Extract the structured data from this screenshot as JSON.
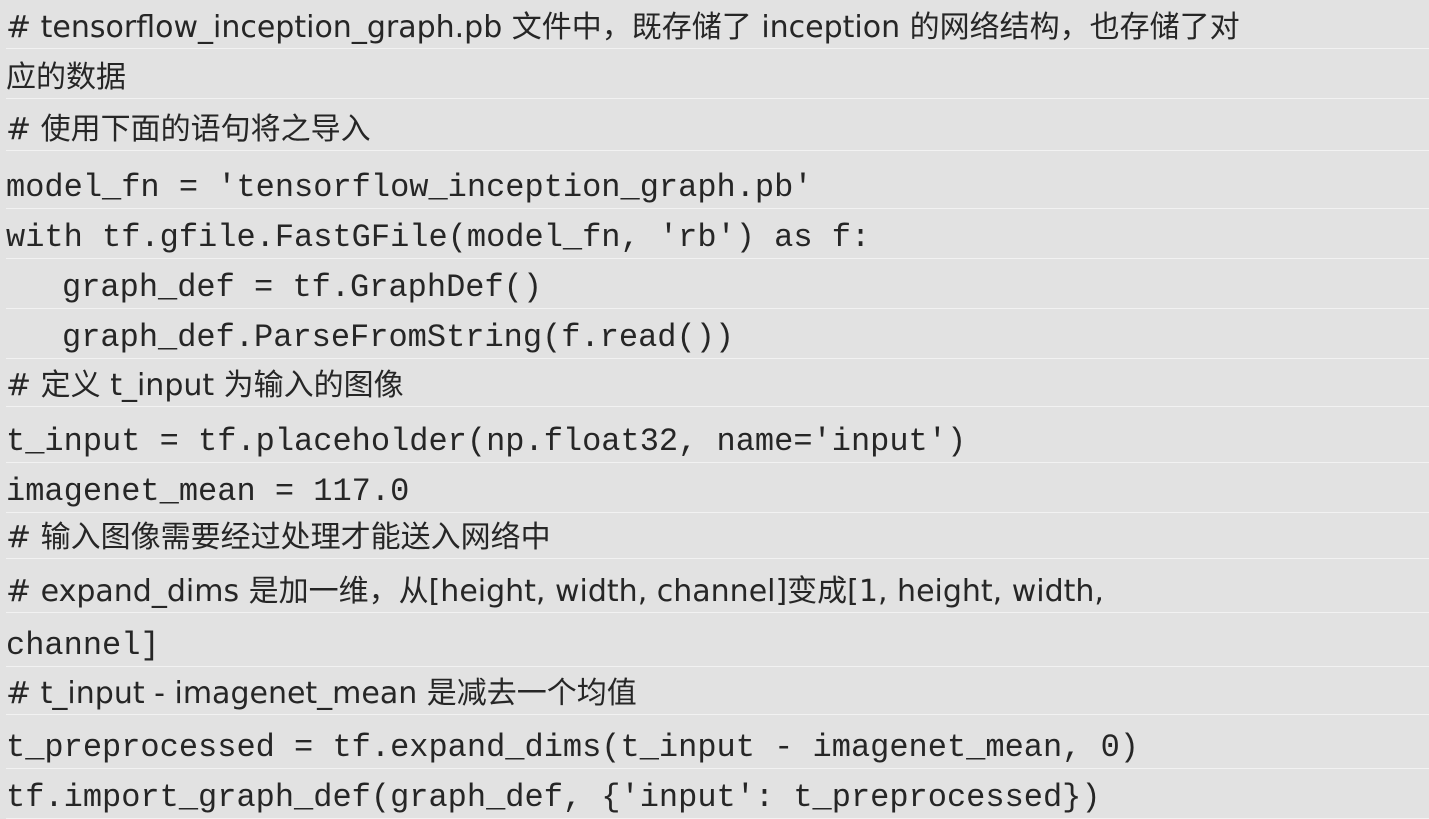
{
  "code": {
    "lines": [
      "# tensorflow_inception_graph.pb 文件中，既存储了 inception 的网络结构，也存储了对",
      "应的数据",
      "# 使用下面的语句将之导入",
      "model_fn = 'tensorflow_inception_graph.pb'",
      "with tf.gfile.FastGFile(model_fn, 'rb') as f:",
      "graph_def = tf.GraphDef()",
      "graph_def.ParseFromString(f.read())",
      "# 定义 t_input 为输入的图像",
      "t_input = tf.placeholder(np.float32, name='input')",
      "imagenet_mean = 117.0",
      "# 输入图像需要经过处理才能送入网络中",
      "# expand_dims 是加一维，从[height, width, channel]变成[1, height, width,",
      "channel]",
      "# t_input - imagenet_mean 是减去一个均值",
      "t_preprocessed = tf.expand_dims(t_input - imagenet_mean, 0)",
      "tf.import_graph_def(graph_def, {'input': t_preprocessed})"
    ]
  },
  "colors": {
    "background": "#e2e2e2",
    "text": "#262626",
    "separator": "#f2f2f2"
  }
}
